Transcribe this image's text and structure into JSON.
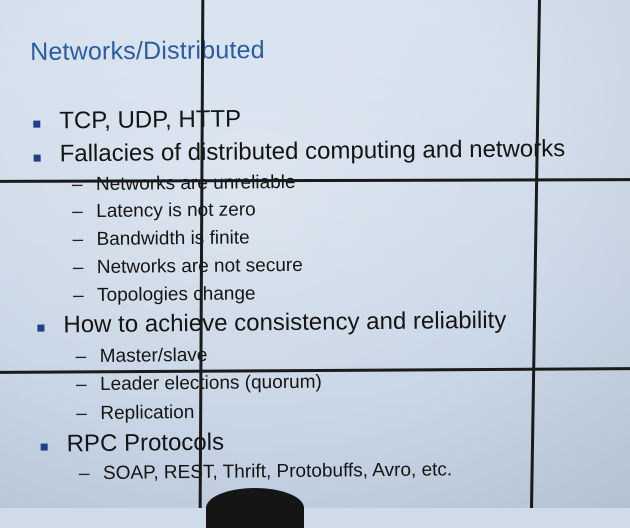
{
  "slide": {
    "title": "Networks/Distributed",
    "items": [
      {
        "text": "TCP, UDP, HTTP",
        "subitems": []
      },
      {
        "text": "Fallacies of distributed computing and networks",
        "subitems": [
          "Networks are unreliable",
          "Latency is not zero",
          "Bandwidth is finite",
          "Networks are not secure",
          "Topologies change"
        ]
      },
      {
        "text": "How to achieve consistency and reliability",
        "subitems": [
          "Master/slave",
          "Leader elections (quorum)",
          "Replication"
        ]
      },
      {
        "text": "RPC Protocols",
        "subitems": [
          "SOAP, REST, Thrift, Protobuffs, Avro, etc."
        ]
      }
    ]
  },
  "colors": {
    "title": "#2a5d9f",
    "bullet": "#1f3f86",
    "background": "#cfdbe9",
    "grid_lines": "#1a1a1a"
  }
}
